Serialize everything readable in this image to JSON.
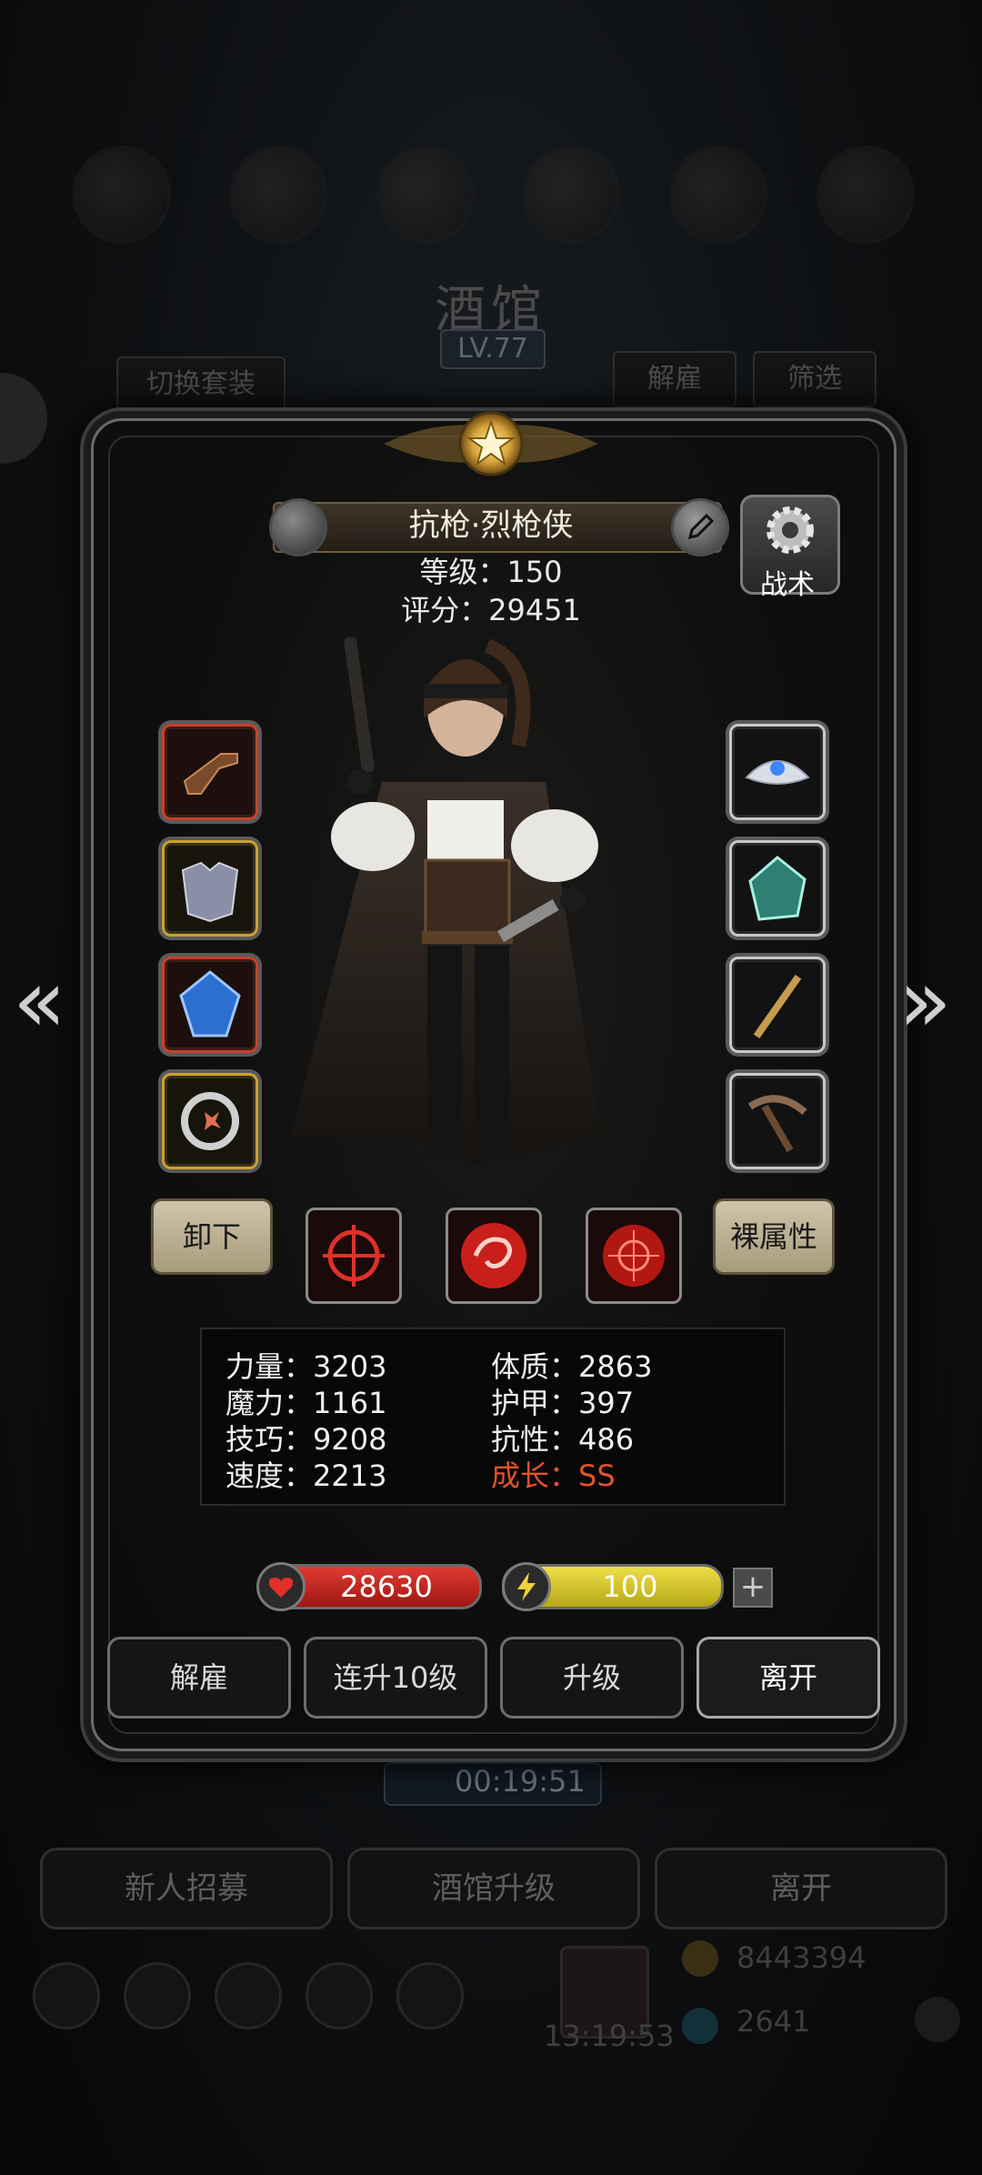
{
  "background": {
    "title": "酒馆",
    "level": "LV.77",
    "switch_outfit": "切换套装",
    "dismiss": "解雇",
    "filter": "筛选",
    "timer": "00:19:51",
    "recruit": "新人招募",
    "upgrade_tavern": "酒馆升级",
    "leave": "离开",
    "gold": "8443394",
    "gems": "2641",
    "clock": "13:19:53"
  },
  "hero": {
    "name": "抗枪·烈枪侠",
    "level_line": "等级：150",
    "score_line": "评分：29451",
    "tactics_label": "战术"
  },
  "slots": {
    "left": [
      {
        "icon": "pistol-icon",
        "frame": "red"
      },
      {
        "icon": "armor-icon",
        "frame": "gold"
      },
      {
        "icon": "blue-gem-icon",
        "frame": "red"
      },
      {
        "icon": "ring-icon",
        "frame": "gold"
      }
    ],
    "right": [
      {
        "icon": "tiara-icon",
        "frame": "white"
      },
      {
        "icon": "crystal-icon",
        "frame": "white"
      },
      {
        "icon": "wand-icon",
        "frame": "white"
      },
      {
        "icon": "pickaxe-icon",
        "frame": "white"
      }
    ]
  },
  "controls": {
    "unequip": "卸下",
    "base_attributes": "裸属性"
  },
  "skills": [
    {
      "icon": "crosshair-skill-icon"
    },
    {
      "icon": "swirl-skill-icon"
    },
    {
      "icon": "target-skill-icon"
    }
  ],
  "attributes": {
    "strength": "力量：3203",
    "constitution": "体质：2863",
    "magic": "魔力：1161",
    "armor": "护甲：397",
    "skill": "技巧：9208",
    "resistance": "抗性：486",
    "speed": "速度：2213",
    "growth": "成长：SS"
  },
  "resources": {
    "hp": "28630",
    "energy": "100",
    "plus": "+"
  },
  "actions": {
    "dismiss": "解雇",
    "level_up_10": "连升10级",
    "upgrade": "升级",
    "leave": "离开"
  },
  "colors": {
    "growth_highlight": "#e0522f",
    "hp_bar": "#c8221f",
    "energy_bar": "#d6c81e"
  }
}
